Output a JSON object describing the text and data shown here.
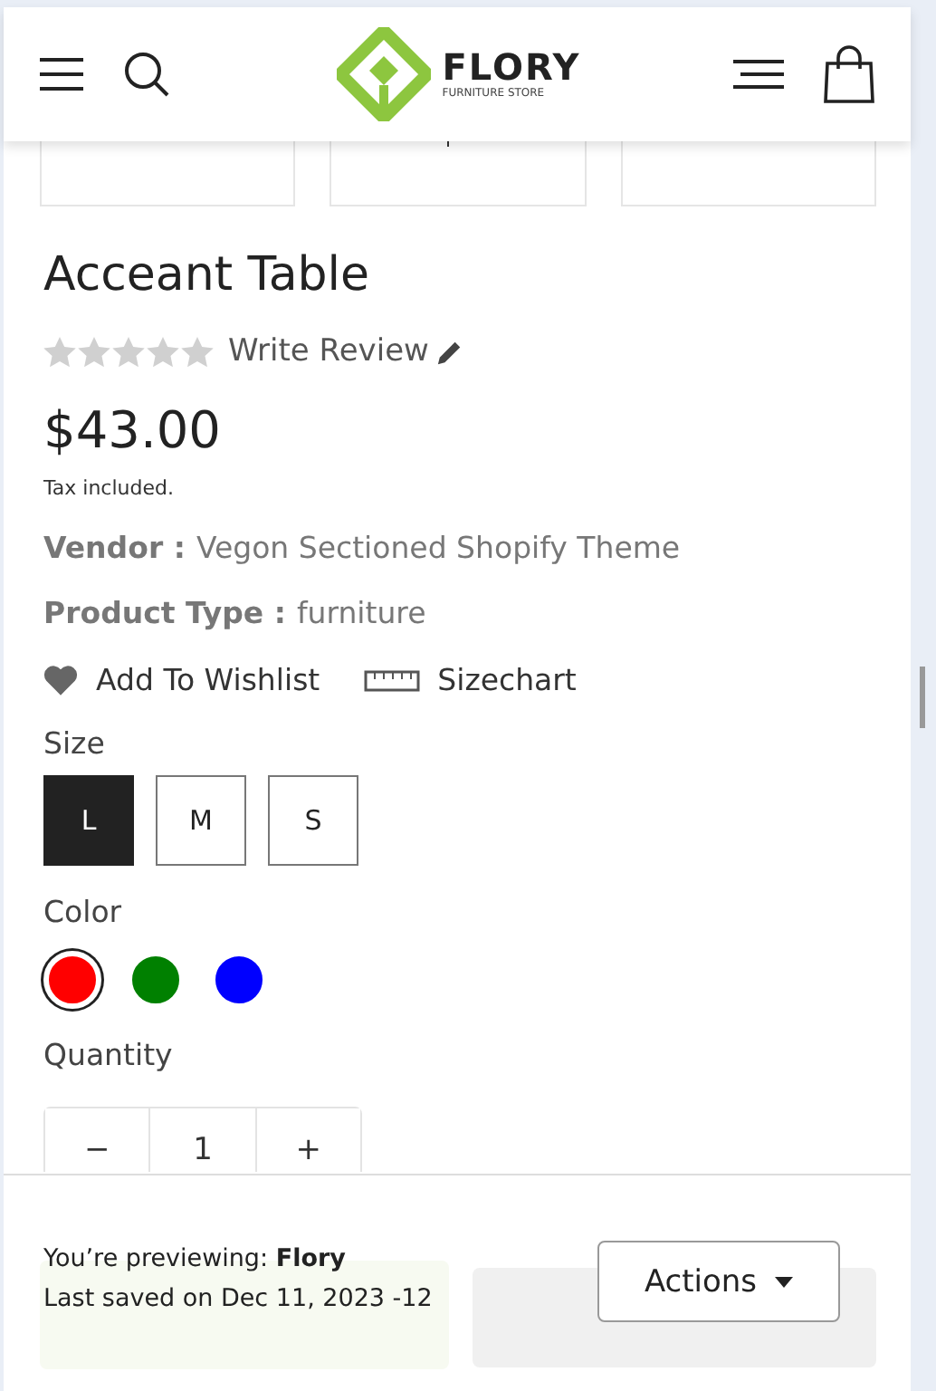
{
  "header": {
    "logo": {
      "name": "FLORY",
      "tagline": "FURNITURE STORE"
    }
  },
  "thumbnails": [
    {
      "kind": "empty"
    },
    {
      "kind": "mark"
    },
    {
      "kind": "empty"
    }
  ],
  "product": {
    "title": "Acceant Table",
    "stars": 0,
    "review_link": "Write Review",
    "price": "$43.00",
    "tax_note": "Tax included.",
    "details": [
      {
        "label": "Vendor :",
        "value": "Vegon Sectioned Shopify Theme"
      },
      {
        "label": "Product Type :",
        "value": "furniture"
      }
    ],
    "wishlist": "Add To Wishlist",
    "sizechart": "Sizechart",
    "size_label": "Size",
    "sizes": [
      {
        "label": "L",
        "selected": true
      },
      {
        "label": "M",
        "selected": false
      },
      {
        "label": "S",
        "selected": false
      }
    ],
    "color_label": "Color",
    "colors": [
      {
        "color": "#ff0000",
        "selected": true
      },
      {
        "color": "#008000",
        "selected": false
      },
      {
        "color": "#0000ff",
        "selected": false
      }
    ],
    "quantity_label": "Quantity",
    "quantity": "1",
    "minus": "−",
    "plus": "+"
  },
  "preview_bar": {
    "prefix": "You’re previewing: ",
    "theme": "Flory",
    "saved": "Last saved on Dec 11, 2023 -12",
    "actions": "Actions"
  }
}
